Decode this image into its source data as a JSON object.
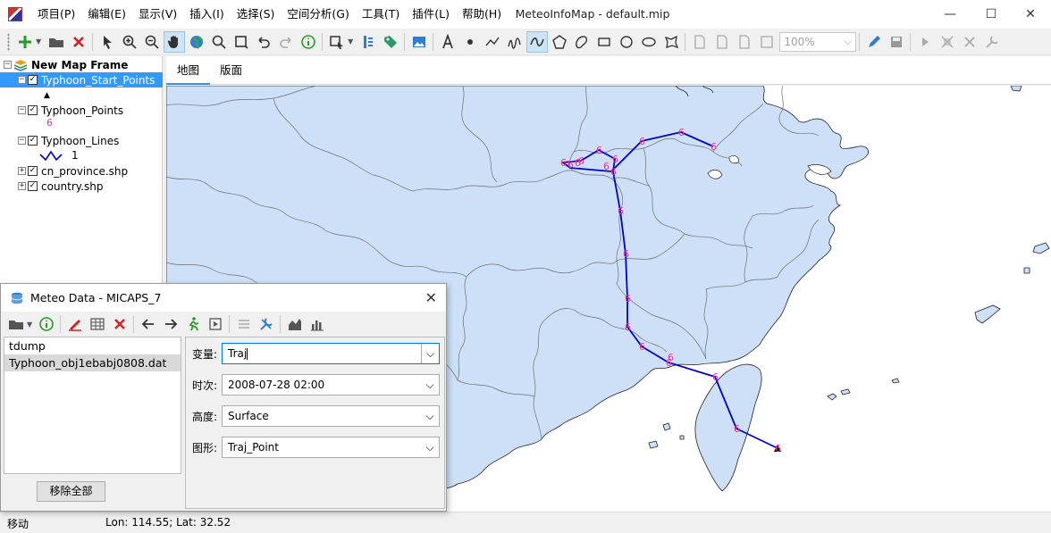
{
  "app": {
    "title": "MeteoInfoMap - default.mip",
    "menu": [
      "项目(P)",
      "编辑(E)",
      "显示(V)",
      "插入(I)",
      "选择(S)",
      "空间分析(G)",
      "工具(T)",
      "插件(L)",
      "帮助(H)"
    ],
    "window_buttons": {
      "minimize": "—",
      "maximize": "☐",
      "close": "✕"
    }
  },
  "toolbar": {
    "zoom_value": "100%",
    "icons": [
      "add-layer-icon",
      "open-folder-icon",
      "remove-layer-icon",
      "select-icon",
      "zoom-in-icon",
      "zoom-out-icon",
      "pan-hand-icon",
      "full-extent-globe-icon",
      "search-icon",
      "select-rect-icon",
      "undo-icon",
      "redo-icon",
      "identify-icon",
      "select-features-icon",
      "legend-icon",
      "label-tag-icon",
      "image-icon",
      "text-icon",
      "point-icon",
      "polyline-icon",
      "freehand-line-icon",
      "curve-icon",
      "polygon-icon",
      "curve-polygon-icon",
      "rectangle-icon",
      "circle-icon",
      "ellipse-icon",
      "freehand-polygon-icon",
      "page-icon-1",
      "page-icon-2",
      "page-icon-3",
      "page-icon-4",
      "edit-pen-icon",
      "save-icon",
      "arrow-icon",
      "move-icon",
      "cross-icon",
      "settings-icon"
    ]
  },
  "layers": {
    "frame": "New Map Frame",
    "items": [
      {
        "name": "Typhoon_Start_Points",
        "legend": "▲"
      },
      {
        "name": "Typhoon_Points",
        "legend": "6"
      },
      {
        "name": "Typhoon_Lines",
        "legend": "1"
      },
      {
        "name": "cn_province.shp"
      },
      {
        "name": "country.shp"
      }
    ]
  },
  "map": {
    "tabs": [
      "地图",
      "版面"
    ],
    "point_label": "6",
    "colors": {
      "land": "#cde0f8",
      "track": "#0000d0",
      "points": "#e0368c",
      "border": "#7a7a7a"
    }
  },
  "status": {
    "mode": "移动",
    "coords": "Lon: 114.55; Lat: 32.52"
  },
  "dialog": {
    "title": "Meteo Data - MICAPS_7",
    "close": "✕",
    "files": [
      "tdump",
      "Typhoon_obj1ebabj0808.dat"
    ],
    "remove_all": "移除全部",
    "fields": [
      {
        "label": "变量:",
        "value": "Traj"
      },
      {
        "label": "时次:",
        "value": "2008-07-28 02:00"
      },
      {
        "label": "高度:",
        "value": "Surface"
      },
      {
        "label": "图形:",
        "value": "Traj_Point"
      }
    ]
  }
}
